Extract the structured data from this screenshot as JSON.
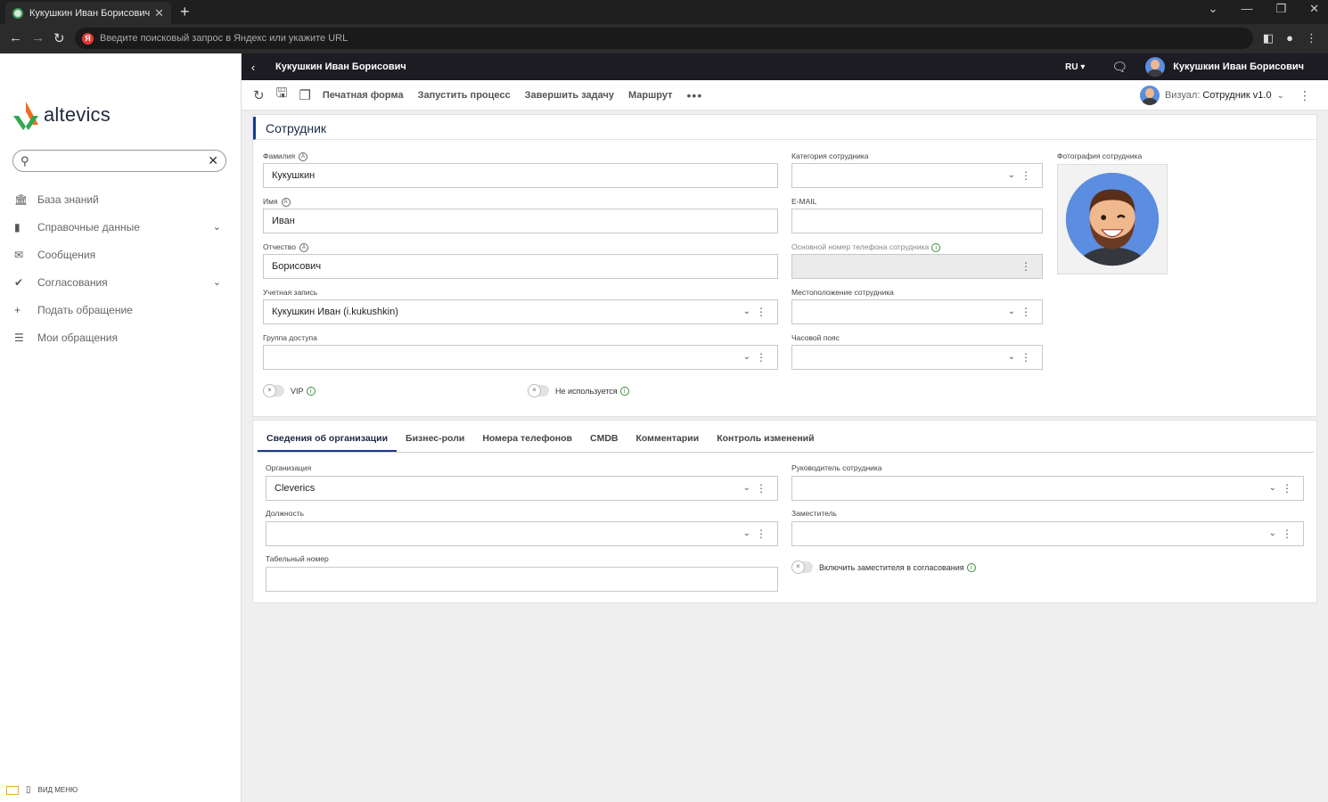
{
  "browser": {
    "tab_title": "Кукушкин Иван Борисович",
    "address_placeholder": "Введите поисковый запрос в Яндекс или укажите URL"
  },
  "sidebar": {
    "logo_text": "altevics",
    "search_value": "",
    "items": [
      {
        "label": "База знаний",
        "icon": "bank-icon",
        "expandable": false
      },
      {
        "label": "Справочные данные",
        "icon": "book-icon",
        "expandable": true
      },
      {
        "label": "Сообщения",
        "icon": "envelope-icon",
        "expandable": false
      },
      {
        "label": "Согласования",
        "icon": "check-icon",
        "expandable": true
      },
      {
        "label": "Подать обращение",
        "icon": "plus-icon",
        "expandable": false
      },
      {
        "label": "Мои обращения",
        "icon": "list-icon",
        "expandable": false
      }
    ],
    "view_menu_label": "ВИД МЕНЮ"
  },
  "header": {
    "title": "Кукушкин Иван Борисович",
    "language": "RU",
    "user_name": "Кукушкин Иван Борисович"
  },
  "toolbar": {
    "actions": [
      "Печатная форма",
      "Запустить процесс",
      "Завершить задачу",
      "Маршрут"
    ],
    "visual_label": "Визуал:",
    "visual_value": "Сотрудник v1.0"
  },
  "employee": {
    "section_title": "Сотрудник",
    "fields": {
      "lastname": {
        "label": "Фамилия",
        "value": "Кукушкин"
      },
      "firstname": {
        "label": "Имя",
        "value": "Иван"
      },
      "middlename": {
        "label": "Отчество",
        "value": "Борисович"
      },
      "account": {
        "label": "Учетная запись",
        "value": "Кукушкин Иван (i.kukushkin)"
      },
      "access_group": {
        "label": "Группа доступа",
        "value": ""
      },
      "category": {
        "label": "Категория сотрудника",
        "value": ""
      },
      "email": {
        "label": "E-MAIL",
        "value": ""
      },
      "phone": {
        "label": "Основной номер телефона сотрудника",
        "value": ""
      },
      "location": {
        "label": "Местоположение сотрудника",
        "value": ""
      },
      "timezone": {
        "label": "Часовой пояс",
        "value": ""
      },
      "photo": {
        "label": "Фотография сотрудника"
      }
    },
    "toggles": {
      "vip": {
        "label": "VIP",
        "on": false
      },
      "unused": {
        "label": "Не используется",
        "on": false
      }
    }
  },
  "org": {
    "tabs": [
      "Сведения об организации",
      "Бизнес-роли",
      "Номера телефонов",
      "CMDB",
      "Комментарии",
      "Контроль изменений"
    ],
    "active_tab": 0,
    "fields": {
      "organization": {
        "label": "Организация",
        "value": "Cleverics"
      },
      "position": {
        "label": "Должность",
        "value": ""
      },
      "tab_number": {
        "label": "Табельный номер",
        "value": ""
      },
      "manager": {
        "label": "Руководитель сотрудника",
        "value": ""
      },
      "deputy": {
        "label": "Заместитель",
        "value": ""
      }
    },
    "toggles": {
      "include_deputy": {
        "label": "Включить заместителя в согласования",
        "on": false
      }
    }
  },
  "colors": {
    "accent": "#1b3a8f",
    "header_bg": "#1c1c22",
    "logo_orange": "#f26b1d",
    "logo_green": "#2fa84f"
  }
}
